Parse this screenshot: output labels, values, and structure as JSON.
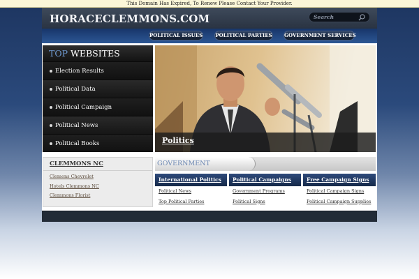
{
  "notice": "This Domain Has Expired, To Renew Please Contact Your Provider.",
  "header": {
    "logo": "HORACECLEMMONS.COM",
    "search_placeholder": "Search"
  },
  "nav": [
    "POLITICAL ISSUES",
    "POLITICAL PARTIES",
    "GOVERNMENT SERVICES"
  ],
  "sidebar": {
    "title_accent": "TOP",
    "title_rest": "WEBSITES",
    "items": [
      "Election Results",
      "Political Data",
      "Political Campaign",
      "Political News",
      "Political Books"
    ]
  },
  "hero": {
    "caption": "Politics"
  },
  "left_box": {
    "title": "CLEMMONS NC",
    "links": [
      "Clemons Chevrolet",
      "Hotels Clemmons NC",
      "Clemmons Florist"
    ]
  },
  "government": {
    "title": "GOVERNMENT",
    "columns": [
      {
        "title": "International Politics",
        "links": [
          "Political News",
          "Top Political Parties"
        ]
      },
      {
        "title": "Political Campaigns",
        "links": [
          "Government Programs",
          "Political Signs"
        ]
      },
      {
        "title": "Free Campaign Signs",
        "links": [
          "Political Campaign Signs",
          "Political Campaign Supplies"
        ]
      }
    ]
  },
  "colors": {
    "page_bg_top": "#1d3560",
    "nav_bar": "#2c5794",
    "accent_blue": "#6d98cf",
    "column_head": "#1f3862",
    "notice_bg": "#fbf6d8"
  }
}
